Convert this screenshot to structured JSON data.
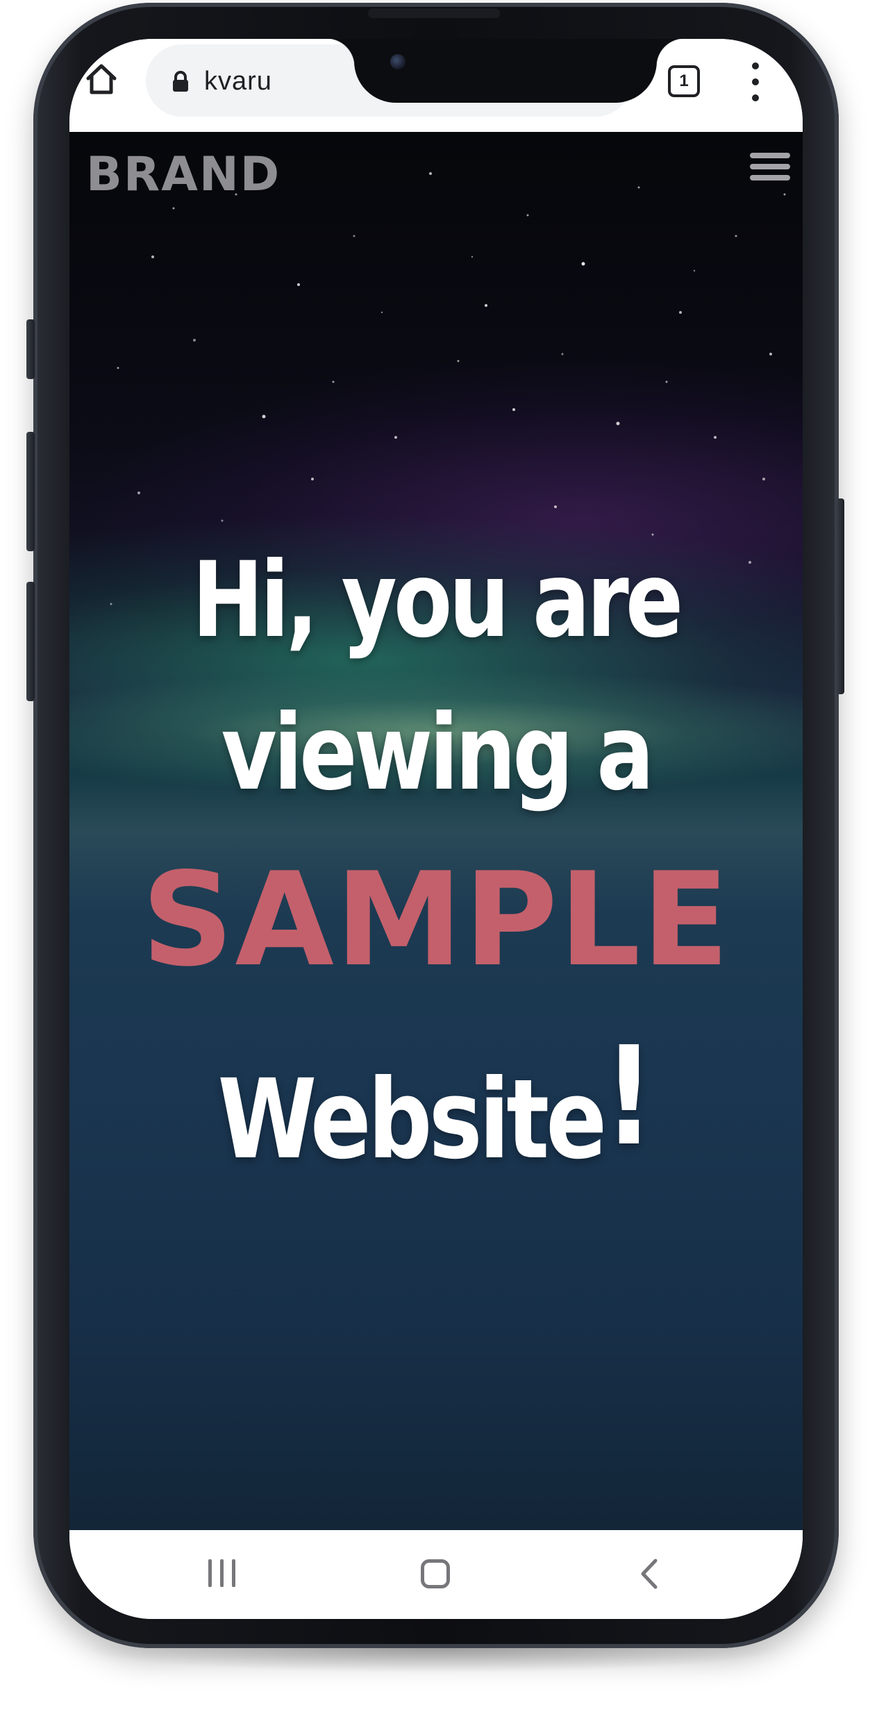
{
  "browser": {
    "url_visible_start": "kvaru",
    "url_visible_end": "/",
    "tab_count": "1",
    "icons": {
      "home": "home-icon",
      "lock": "lock-icon",
      "more": "more-vertical-icon"
    }
  },
  "site": {
    "brand": "BRAND",
    "menu_icon": "hamburger-menu-icon"
  },
  "hero": {
    "line1": "Hi, you are",
    "line2": "viewing a",
    "highlight": "SAMPLE",
    "line4_word": "Website",
    "line4_punct": "!"
  },
  "android_nav": {
    "recents_icon": "recents-icon",
    "home_icon": "home-circle-icon",
    "back_icon": "back-chevron-icon"
  },
  "colors": {
    "highlight": "#c4606b",
    "brand_text": "#8e8e92",
    "hero_text": "#ffffff"
  }
}
